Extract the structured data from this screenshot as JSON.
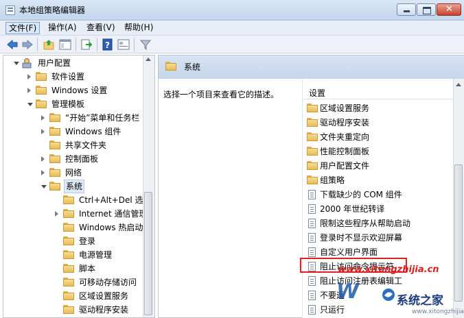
{
  "window": {
    "title": "本地组策略编辑器"
  },
  "menu": [
    {
      "id": "file",
      "label": "文件(F)"
    },
    {
      "id": "action",
      "label": "操作(A)"
    },
    {
      "id": "view",
      "label": "查看(V)"
    },
    {
      "id": "help",
      "label": "帮助(H)"
    }
  ],
  "toolbar": {
    "icons": [
      "back-arrow-icon",
      "forward-arrow-icon",
      "up-folder-icon",
      "show-tree-icon",
      "export-list-icon",
      "help-icon",
      "properties-icon",
      "filter-icon"
    ]
  },
  "tree": {
    "items": [
      {
        "label": "用户配置",
        "level": 0,
        "expand": "e",
        "icon": "user-config-icon"
      },
      {
        "label": "软件设置",
        "level": 1,
        "expand": "c",
        "icon": "folder"
      },
      {
        "label": "Windows 设置",
        "level": 1,
        "expand": "c",
        "icon": "folder"
      },
      {
        "label": "管理模板",
        "level": 1,
        "expand": "e",
        "icon": "folder"
      },
      {
        "label": "“开始”菜单和任务栏",
        "level": 2,
        "expand": "c",
        "icon": "folder"
      },
      {
        "label": "Windows 组件",
        "level": 2,
        "expand": "c",
        "icon": "folder"
      },
      {
        "label": "共享文件夹",
        "level": 2,
        "expand": "",
        "icon": "folder"
      },
      {
        "label": "控制面板",
        "level": 2,
        "expand": "c",
        "icon": "folder"
      },
      {
        "label": "网络",
        "level": 2,
        "expand": "c",
        "icon": "folder"
      },
      {
        "label": "系统",
        "level": 2,
        "expand": "e",
        "icon": "folder",
        "selected": true
      },
      {
        "label": "Ctrl+Alt+Del 选项",
        "level": 3,
        "expand": "",
        "icon": "folder"
      },
      {
        "label": "Internet 通信管理",
        "level": 3,
        "expand": "c",
        "icon": "folder"
      },
      {
        "label": "Windows 热启动",
        "level": 3,
        "expand": "",
        "icon": "folder"
      },
      {
        "label": "登录",
        "level": 3,
        "expand": "",
        "icon": "folder"
      },
      {
        "label": "电源管理",
        "level": 3,
        "expand": "",
        "icon": "folder"
      },
      {
        "label": "脚本",
        "level": 3,
        "expand": "",
        "icon": "folder"
      },
      {
        "label": "可移动存储访问",
        "level": 3,
        "expand": "",
        "icon": "folder"
      },
      {
        "label": "区域设置服务",
        "level": 3,
        "expand": "",
        "icon": "folder"
      },
      {
        "label": "驱动程序安装",
        "level": 3,
        "expand": "",
        "icon": "folder"
      }
    ]
  },
  "right": {
    "header_title": "系统",
    "description": "选择一个项目来查看它的描述。",
    "column_header": "设置",
    "items": [
      {
        "label": "区域设置服务",
        "type": "folder"
      },
      {
        "label": "驱动程序安装",
        "type": "folder"
      },
      {
        "label": "文件夹重定向",
        "type": "folder"
      },
      {
        "label": "性能控制面板",
        "type": "folder"
      },
      {
        "label": "用户配置文件",
        "type": "folder"
      },
      {
        "label": "组策略",
        "type": "folder"
      },
      {
        "label": "下载缺少的 COM 组件",
        "type": "policy"
      },
      {
        "label": "2000 年世纪转译",
        "type": "policy"
      },
      {
        "label": "限制这些程序从帮助启动",
        "type": "policy"
      },
      {
        "label": "登录时不显示欢迎屏幕",
        "type": "policy"
      },
      {
        "label": "自定义用户界面",
        "type": "policy"
      },
      {
        "label": "阻止访问命令提示符",
        "type": "policy",
        "highlighted": true
      },
      {
        "label": "阻止访问注册表编辑工",
        "type": "policy"
      },
      {
        "label": "不要运",
        "type": "policy"
      },
      {
        "label": "只运行",
        "type": "policy"
      }
    ]
  },
  "watermark": {
    "url": "www.xitongzhijia.cn",
    "brand": "系统之家",
    "sub": "www.xitongzhijia.cn"
  },
  "colors": {
    "highlight_box": "#e02020",
    "header_bg": "#c6d6ec"
  }
}
